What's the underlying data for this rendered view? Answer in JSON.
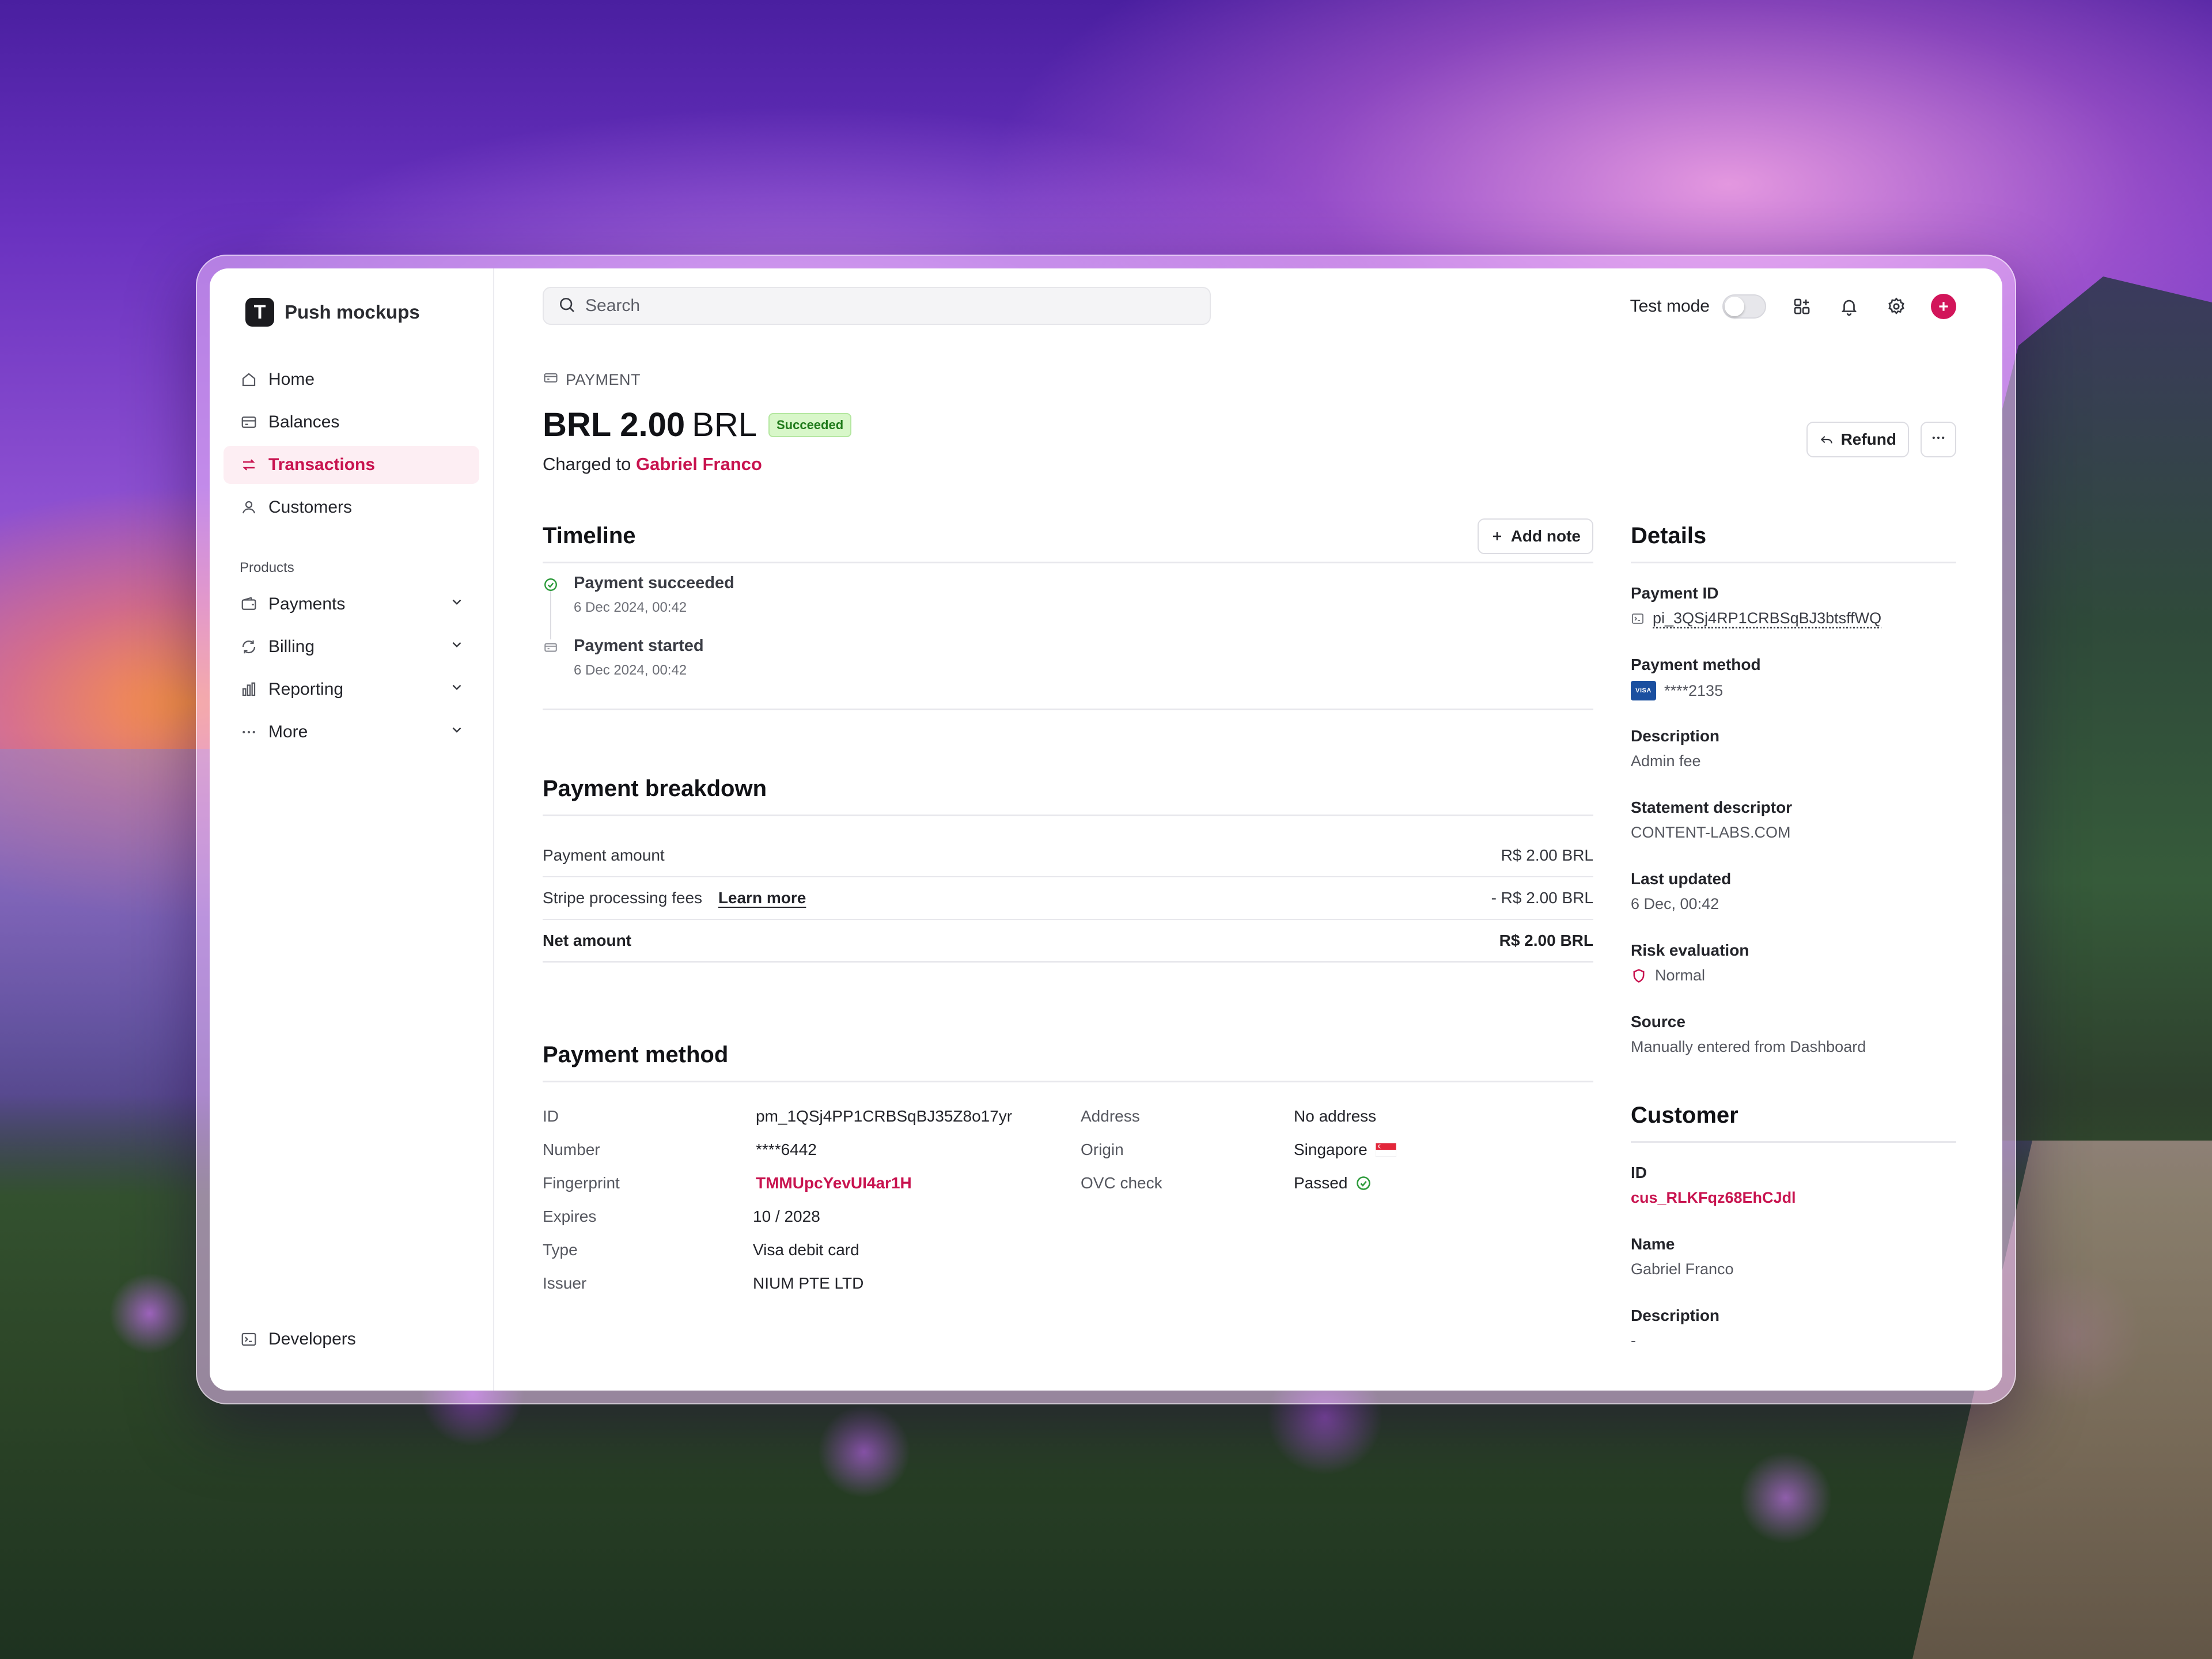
{
  "sidebar": {
    "brand_initial": "T",
    "brand_name": "Push mockups",
    "nav": [
      {
        "label": "Home",
        "icon": "home-icon"
      },
      {
        "label": "Balances",
        "icon": "balances-icon"
      },
      {
        "label": "Transactions",
        "icon": "transactions-icon",
        "active": true
      },
      {
        "label": "Customers",
        "icon": "customers-icon"
      }
    ],
    "products_label": "Products",
    "products": [
      {
        "label": "Payments",
        "icon": "wallet-icon"
      },
      {
        "label": "Billing",
        "icon": "billing-icon"
      },
      {
        "label": "Reporting",
        "icon": "reporting-icon"
      },
      {
        "label": "More",
        "icon": "more-icon"
      }
    ],
    "developers_label": "Developers"
  },
  "topbar": {
    "search_placeholder": "Search",
    "test_mode_label": "Test mode",
    "test_mode_on": false
  },
  "payment": {
    "kicker": "PAYMENT",
    "amount": "BRL 2.00",
    "currency": "BRL",
    "status": "Succeeded",
    "charged_prefix": "Charged to",
    "customer_name": "Gabriel Franco",
    "refund_label": "Refund"
  },
  "timeline": {
    "title": "Timeline",
    "add_note_label": "Add note",
    "items": [
      {
        "title": "Payment succeeded",
        "time": "6 Dec 2024, 00:42"
      },
      {
        "title": "Payment started",
        "time": "6 Dec 2024, 00:42"
      }
    ]
  },
  "breakdown": {
    "title": "Payment breakdown",
    "rows": [
      {
        "label": "Payment amount",
        "value": "R$ 2.00 BRL"
      },
      {
        "label": "Stripe processing fees",
        "link": "Learn more",
        "value": "-  R$ 2.00 BRL"
      },
      {
        "label": "Net amount",
        "value": "R$ 2.00 BRL"
      }
    ]
  },
  "payment_method": {
    "title": "Payment method",
    "left": [
      {
        "label": "ID",
        "value": "pm_1QSj4PP1CRBSqBJ35Z8o17yr"
      },
      {
        "label": "Number",
        "value": "****6442"
      },
      {
        "label": "Fingerprint",
        "value": "TMMUpcYevUI4ar1H"
      },
      {
        "label": "Expires",
        "value": "10 / 2028"
      },
      {
        "label": "Type",
        "value": "Visa debit card"
      },
      {
        "label": "Issuer",
        "value": "NIUM PTE LTD"
      }
    ],
    "right": [
      {
        "label": "Address",
        "value": "No address"
      },
      {
        "label": "Origin",
        "value": "Singapore"
      },
      {
        "label": "OVC check",
        "value": "Passed"
      }
    ]
  },
  "details": {
    "title": "Details",
    "payment_id_label": "Payment ID",
    "payment_id": "pi_3QSj4RP1CRBSqBJ3btsffWQ",
    "payment_method_label": "Payment method",
    "card_brand": "VISA",
    "card_last4": "****2135",
    "description_label": "Description",
    "description": "Admin fee",
    "statement_label": "Statement descriptor",
    "statement": "CONTENT-LABS.COM",
    "last_updated_label": "Last updated",
    "last_updated": "6 Dec, 00:42",
    "risk_label": "Risk evaluation",
    "risk": "Normal",
    "source_label": "Source",
    "source": "Manually entered from Dashboard"
  },
  "customer": {
    "title": "Customer",
    "id_label": "ID",
    "id": "cus_RLKFqz68EhCJdl",
    "name_label": "Name",
    "name": "Gabriel Franco",
    "description_label": "Description",
    "description": "-"
  },
  "colors": {
    "accent": "#c8134f",
    "success_bg": "#d8f7c9",
    "success_text": "#1f7a1a"
  }
}
